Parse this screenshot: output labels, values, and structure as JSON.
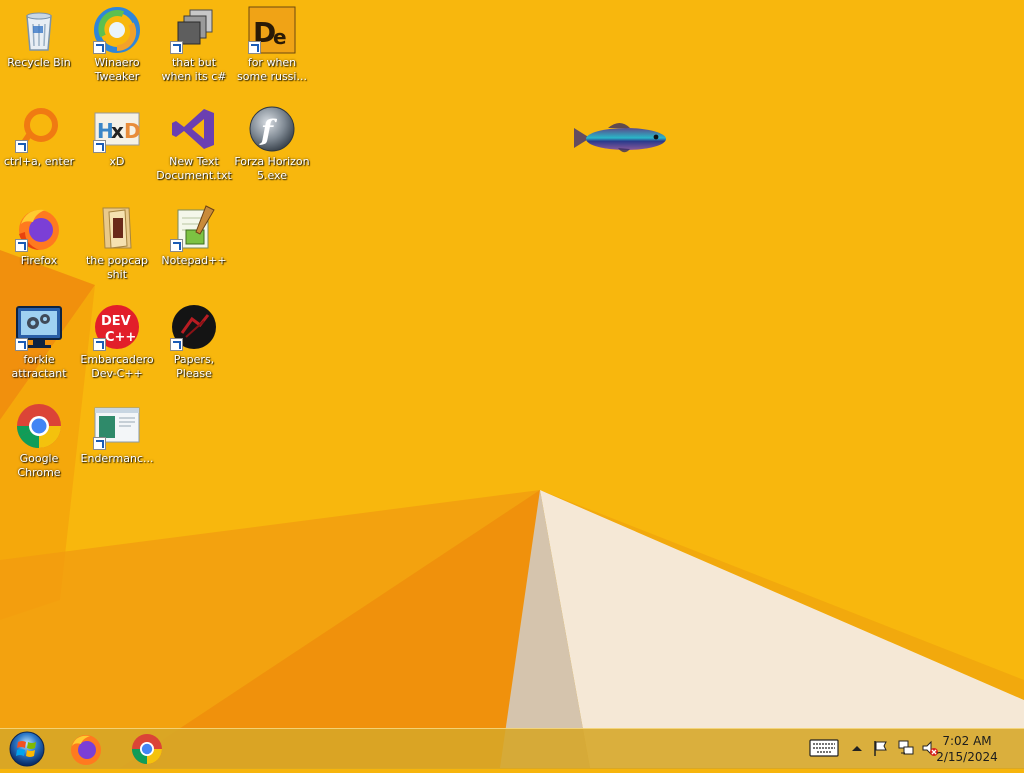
{
  "desktop": {
    "icons": [
      {
        "label": "Recycle Bin",
        "icon": "recycle-bin-icon",
        "shortcut": false
      },
      {
        "label": "Winaero Tweaker",
        "icon": "winaero-tweaker-icon",
        "shortcut": true
      },
      {
        "label": "that but when its c#",
        "icon": "stack-windows-icon",
        "shortcut": true
      },
      {
        "label": "for when some russi...",
        "icon": "de-app-icon",
        "shortcut": true
      },
      {
        "label": "ctrl+a, enter",
        "icon": "orange-ring-icon",
        "shortcut": true
      },
      {
        "label": "xD",
        "icon": "hxd-icon",
        "shortcut": true
      },
      {
        "label": "New Text Document.txt",
        "icon": "visual-studio-icon",
        "shortcut": false
      },
      {
        "label": "Forza Horizon 5.exe",
        "icon": "flash-player-icon",
        "shortcut": false
      },
      {
        "label": "Firefox",
        "icon": "firefox-icon",
        "shortcut": true
      },
      {
        "label": "the popcap shit",
        "icon": "folder-icon",
        "shortcut": false
      },
      {
        "label": "Notepad++",
        "icon": "notepad-plus-plus-icon",
        "shortcut": true
      },
      {
        "label": "forkie attractant",
        "icon": "monitor-gear-icon",
        "shortcut": true
      },
      {
        "label": "Embarcadero Dev-C++",
        "icon": "dev-cpp-icon",
        "shortcut": true
      },
      {
        "label": "Papers, Please",
        "icon": "papers-please-icon",
        "shortcut": true
      },
      {
        "label": "Google Chrome",
        "icon": "chrome-icon",
        "shortcut": false
      },
      {
        "label": "Endermanc...",
        "icon": "window-app-icon",
        "shortcut": true
      }
    ]
  },
  "taskbar": {
    "start_icon": "windows-start-orb-icon",
    "pinned": [
      {
        "name": "Firefox",
        "icon": "firefox-icon"
      },
      {
        "name": "Google Chrome",
        "icon": "chrome-icon"
      }
    ],
    "tray": {
      "keyboard_icon": "touch-keyboard-icon",
      "overflow_icon": "chevron-up-icon",
      "flag_icon": "action-center-flag-icon",
      "network_icon": "network-icon",
      "volume_icon": "volume-muted-icon",
      "time": "7:02 AM",
      "date": "2/15/2024"
    }
  },
  "colors": {
    "wallpaper_main": "#f7b50c",
    "wallpaper_dark": "#e8790a",
    "wallpaper_light": "#f6e9d6",
    "taskbar": "#d6a628"
  }
}
